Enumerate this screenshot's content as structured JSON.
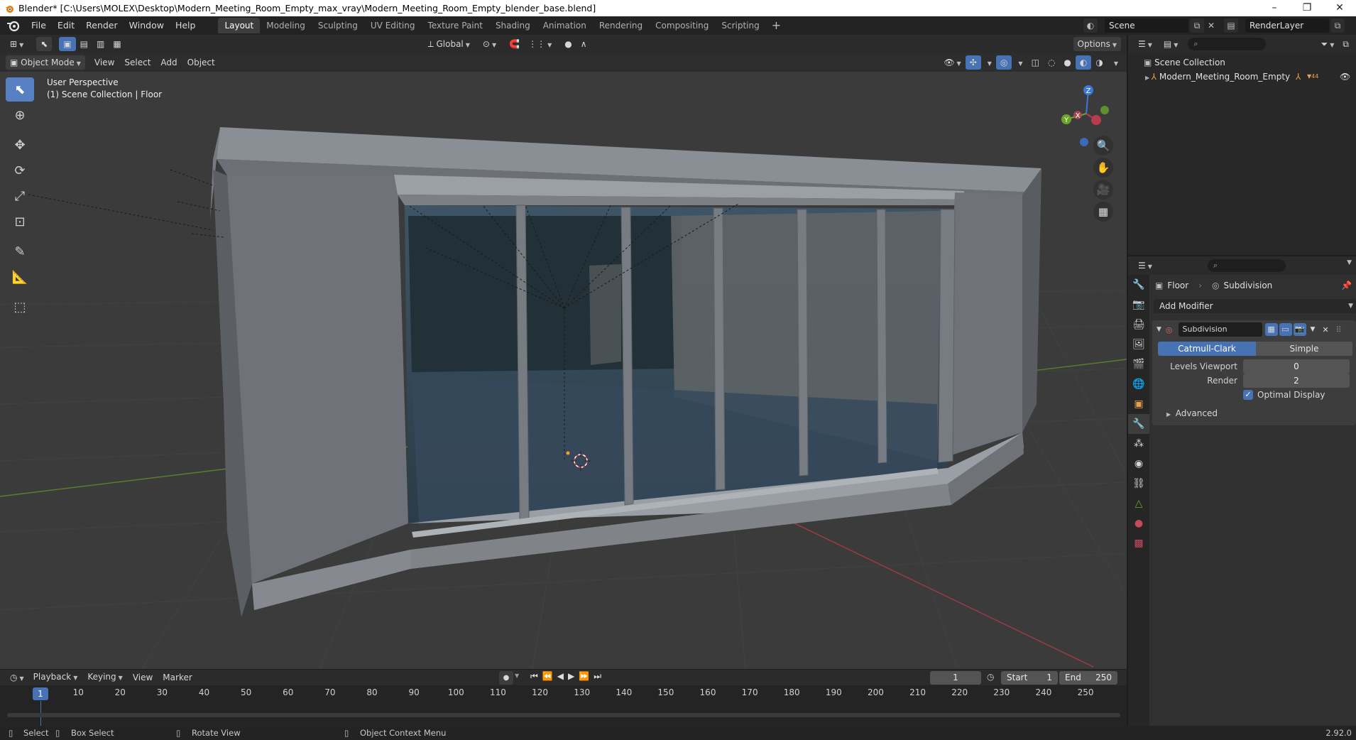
{
  "window": {
    "title": "Blender* [C:\\Users\\MOLEX\\Desktop\\Modern_Meeting_Room_Empty_max_vray\\Modern_Meeting_Room_Empty_blender_base.blend]",
    "minimize": "–",
    "restore": "❐",
    "close": "✕"
  },
  "menu": [
    "File",
    "Edit",
    "Render",
    "Window",
    "Help"
  ],
  "workspaces": [
    "Layout",
    "Modeling",
    "Sculpting",
    "UV Editing",
    "Texture Paint",
    "Shading",
    "Animation",
    "Rendering",
    "Compositing",
    "Scripting"
  ],
  "workspace_add": "+",
  "scene": {
    "name": "Scene",
    "render_layer": "RenderLayer"
  },
  "viewport": {
    "orientation": "Global",
    "options": "Options",
    "mode": "Object Mode",
    "menus": [
      "View",
      "Select",
      "Add",
      "Object"
    ],
    "perspective_label": "User Perspective",
    "collection_label": "(1) Scene Collection | Floor",
    "gizmo_labels": {
      "z": "Z",
      "y": "Y",
      "x": "X"
    }
  },
  "outliner": {
    "root": "Scene Collection",
    "items": [
      {
        "name": "Modern_Meeting_Room_Empty",
        "badge": "44"
      }
    ]
  },
  "properties": {
    "object": "Floor",
    "modifier_crumb": "Subdivision",
    "add_modifier": "Add Modifier",
    "modifier": {
      "name": "Subdivision",
      "type_options": [
        "Catmull-Clark",
        "Simple"
      ],
      "levels_viewport_label": "Levels Viewport",
      "levels_viewport": "0",
      "render_label": "Render",
      "render": "2",
      "optimal_display_label": "Optimal Display",
      "optimal_display": true,
      "advanced_label": "Advanced"
    }
  },
  "timeline": {
    "menus": [
      "Playback",
      "Keying",
      "View",
      "Marker"
    ],
    "current_frame": "1",
    "start_label": "Start",
    "start": "1",
    "end_label": "End",
    "end": "250",
    "frame_marks": [
      "10",
      "20",
      "30",
      "40",
      "50",
      "60",
      "70",
      "80",
      "90",
      "100",
      "110",
      "120",
      "130",
      "140",
      "150",
      "160",
      "170",
      "180",
      "190",
      "200",
      "210",
      "220",
      "230",
      "240",
      "250"
    ]
  },
  "statusbar": {
    "select": "Select",
    "box_select": "Box Select",
    "rotate_view": "Rotate View",
    "context_menu": "Object Context Menu",
    "version": "2.92.0"
  },
  "colors": {
    "accent": "#4772b3",
    "active_tool": "#5680c2",
    "x_axis": "#b53d4e",
    "y_axis": "#6aa52a",
    "z_axis": "#3c78d8"
  }
}
